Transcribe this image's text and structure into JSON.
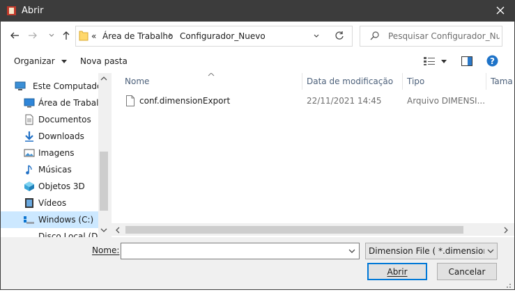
{
  "window": {
    "title": "Abrir"
  },
  "nav": {
    "crumbs": [
      "«",
      "Área de Trabalho",
      "Configurador_Nuevo"
    ],
    "search_placeholder": "Pesquisar Configurador_Nue..."
  },
  "toolbar": {
    "organize": "Organizar",
    "new_folder": "Nova pasta"
  },
  "sidebar": {
    "items": [
      {
        "label": "Este Computador",
        "icon": "computer-icon"
      },
      {
        "label": "Área de Trabalho",
        "icon": "desktop-icon"
      },
      {
        "label": "Documentos",
        "icon": "documents-icon"
      },
      {
        "label": "Downloads",
        "icon": "downloads-icon"
      },
      {
        "label": "Imagens",
        "icon": "pictures-icon"
      },
      {
        "label": "Músicas",
        "icon": "music-icon"
      },
      {
        "label": "Objetos 3D",
        "icon": "objects-3d-icon"
      },
      {
        "label": "Vídeos",
        "icon": "videos-icon"
      },
      {
        "label": "Windows (C:)",
        "icon": "drive-icon"
      },
      {
        "label": "Disco Local (D:)",
        "icon": "drive-icon"
      }
    ]
  },
  "files": {
    "columns": [
      "Nome",
      "Data de modificação",
      "Tipo",
      "Tama"
    ],
    "rows": [
      {
        "name": "conf.dimensionExport",
        "modified": "22/11/2021 14:45",
        "type": "Arquivo DIMENSI..."
      }
    ]
  },
  "footer": {
    "name_label": "Nome:",
    "name_value": "",
    "filetype": "Dimension File  ( *.dimensionExport)",
    "open": "Abrir",
    "cancel": "Cancelar"
  },
  "colors": {
    "titlebar": "#3c3c3c",
    "selection": "#cce8ff",
    "accent": "#0078d7"
  }
}
